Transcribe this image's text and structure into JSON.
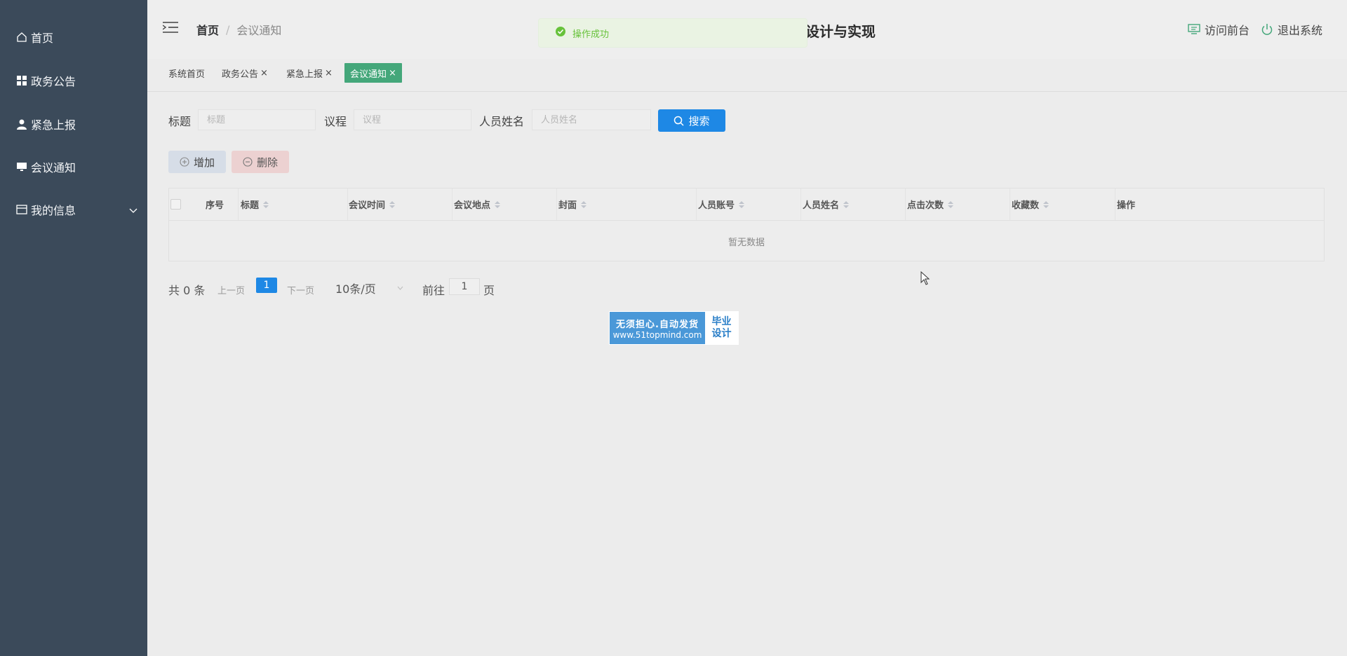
{
  "sidebar": {
    "items": [
      {
        "label": "首页",
        "icon": "home-icon"
      },
      {
        "label": "政务公告",
        "icon": "grid-icon"
      },
      {
        "label": "紧急上报",
        "icon": "user-icon"
      },
      {
        "label": "会议通知",
        "icon": "monitor-icon"
      },
      {
        "label": "我的信息",
        "icon": "card-icon"
      }
    ]
  },
  "header": {
    "breadcrumb_home": "首页",
    "breadcrumb_sep": "/",
    "breadcrumb_current": "会议通知",
    "system_title": "设计与实现",
    "visit_front": "访问前台",
    "logout": "退出系统"
  },
  "toast": {
    "message": "操作成功",
    "color": "#67c23a"
  },
  "tabs": [
    {
      "label": "系统首页",
      "closable": false
    },
    {
      "label": "政务公告",
      "closable": true
    },
    {
      "label": "紧急上报",
      "closable": true
    },
    {
      "label": "会议通知",
      "closable": true,
      "active": true
    }
  ],
  "tab_close": "×",
  "search": {
    "title_label": "标题",
    "title_placeholder": "标题",
    "agenda_label": "议程",
    "agenda_placeholder": "议程",
    "name_label": "人员姓名",
    "name_placeholder": "人员姓名",
    "button": "搜索"
  },
  "actions": {
    "add": "增加",
    "delete": "删除"
  },
  "table": {
    "columns": [
      "序号",
      "标题",
      "会议时间",
      "会议地点",
      "封面",
      "人员账号",
      "人员姓名",
      "点击次数",
      "收藏数",
      "操作"
    ],
    "empty_text": "暂无数据"
  },
  "pagination": {
    "total": "共 0 条",
    "prev": "上一页",
    "current_page": "1",
    "next": "下一页",
    "page_size": "10条/页",
    "goto": "前往",
    "goto_value": "1",
    "page_unit": "页"
  },
  "badge": {
    "line1": "无须担心.自动发货",
    "line2": "www.51topmind.com",
    "right1": "毕业",
    "right2": "设计"
  },
  "colors": {
    "sidebar": "#3b4a5a",
    "primary": "#1e88e5",
    "active_tab": "#44a77a"
  }
}
